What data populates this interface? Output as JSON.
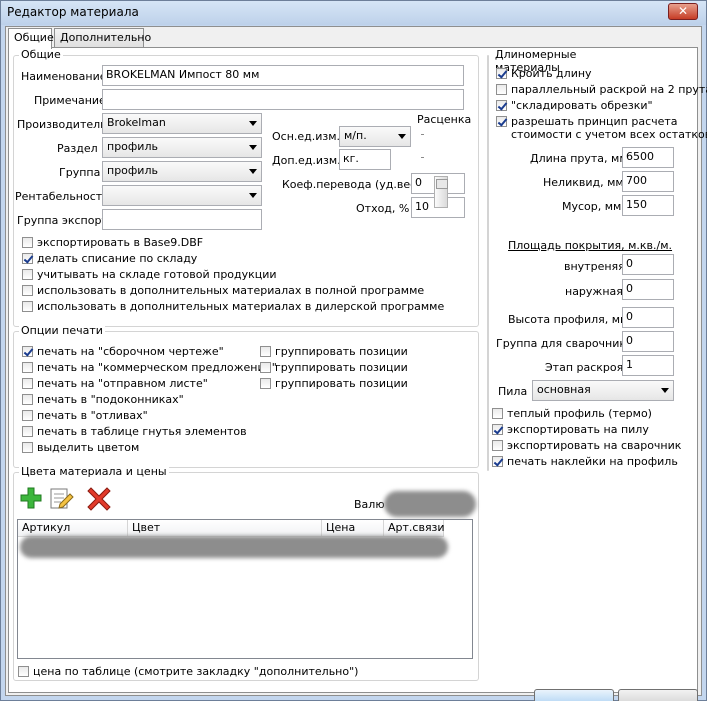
{
  "window": {
    "title": "Редактор материала",
    "close_glyph": "✕"
  },
  "tabs": [
    {
      "label": "Общие"
    },
    {
      "label": "Дополнительно"
    }
  ],
  "general": {
    "title": "Общие",
    "name_label": "Наименование",
    "name_value": "BROKELMAN Импост 80 мм",
    "note_label": "Примечание",
    "note_value": "",
    "manufacturer_label": "Производитель",
    "manufacturer_value": "Brokelman",
    "section_label": "Раздел",
    "section_value": "профиль",
    "group_label": "Группа",
    "group_value": "профиль",
    "profitability_label": "Рентабельность",
    "profitability_value": "",
    "export_group_label": "Группа экспорт",
    "export_group_value": "",
    "main_unit_label": "Осн.ед.изм.",
    "main_unit_value": "м/п.",
    "extra_unit_label": "Доп.ед.изм.",
    "extra_unit_value": "кг.",
    "rate_label": "Расценка",
    "coef_label": "Коеф.перевода (уд.вес)",
    "coef_value": "0",
    "waste_label": "Отход, %",
    "waste_value": "10",
    "checks": [
      {
        "label": "экспортировать в Base9.DBF",
        "checked": false
      },
      {
        "label": "делать списание по складу",
        "checked": true
      },
      {
        "label": "учитывать на складе готовой продукции",
        "checked": false
      },
      {
        "label": "использовать в дополнительных материалах в полной программе",
        "checked": false
      },
      {
        "label": "использовать в дополнительных материалах в дилерской программе",
        "checked": false
      }
    ]
  },
  "print_options": {
    "title": "Опции печати",
    "left": [
      {
        "label": "печать на \"сборочном чертеже\"",
        "checked": true
      },
      {
        "label": "печать на \"коммерческом предложении\"",
        "checked": false
      },
      {
        "label": "печать на \"отправном листе\"",
        "checked": false
      },
      {
        "label": "печать в \"подоконниках\"",
        "checked": false
      },
      {
        "label": "печать в \"отливах\"",
        "checked": false
      },
      {
        "label": "печать в таблице гнутья элементов",
        "checked": false
      },
      {
        "label": "выделить цветом",
        "checked": false
      }
    ],
    "right": [
      {
        "label": "группировать позиции",
        "checked": false
      },
      {
        "label": "группировать позиции",
        "checked": false
      },
      {
        "label": "группировать позиции",
        "checked": false
      }
    ]
  },
  "colors": {
    "title": "Цвета материала и цены",
    "currency_label": "Валю",
    "columns": [
      "Артикул",
      "Цвет",
      "Цена",
      "Арт.связи"
    ],
    "price_from_table": {
      "label": "цена по таблице (смотрите закладку \"дополнительно\")",
      "checked": false
    },
    "icons": [
      "add-icon",
      "edit-icon",
      "delete-icon"
    ]
  },
  "linear": {
    "title": "Длиномерные материалы",
    "checks": [
      {
        "label": "Кроить длину",
        "checked": true
      },
      {
        "label": "параллельный раскрой на 2 прута",
        "checked": false
      },
      {
        "label": "\"складировать обрезки\"",
        "checked": true
      },
      {
        "label": "разрешать принцип расчета",
        "label2": "стоимости с учетом всех остатков",
        "checked": true
      }
    ],
    "bar_length_label": "Длина прута, мм.",
    "bar_length_value": "6500",
    "illiquid_label": "Неликвид, мм.",
    "illiquid_value": "700",
    "trash_label": "Мусор, мм.",
    "trash_value": "150",
    "coverage_title": "Площадь покрытия, м.кв./м.",
    "inner_label": "внутреняя",
    "inner_value": "0",
    "outer_label": "наружная",
    "outer_value": "0",
    "height_label": "Высота профиля, мм.",
    "height_value": "0",
    "welder_group_label": "Группа для сварочника",
    "welder_group_value": "0",
    "cut_stage_label": "Этап раскроя",
    "cut_stage_value": "1",
    "saw_label": "Пила",
    "saw_value": "основная",
    "bottom_checks": [
      {
        "label": "теплый профиль (термо)",
        "checked": false
      },
      {
        "label": "экспортировать на пилу",
        "checked": true
      },
      {
        "label": "экспортировать на сварочник",
        "checked": false
      },
      {
        "label": "печать наклейки на профиль",
        "checked": true
      }
    ]
  }
}
